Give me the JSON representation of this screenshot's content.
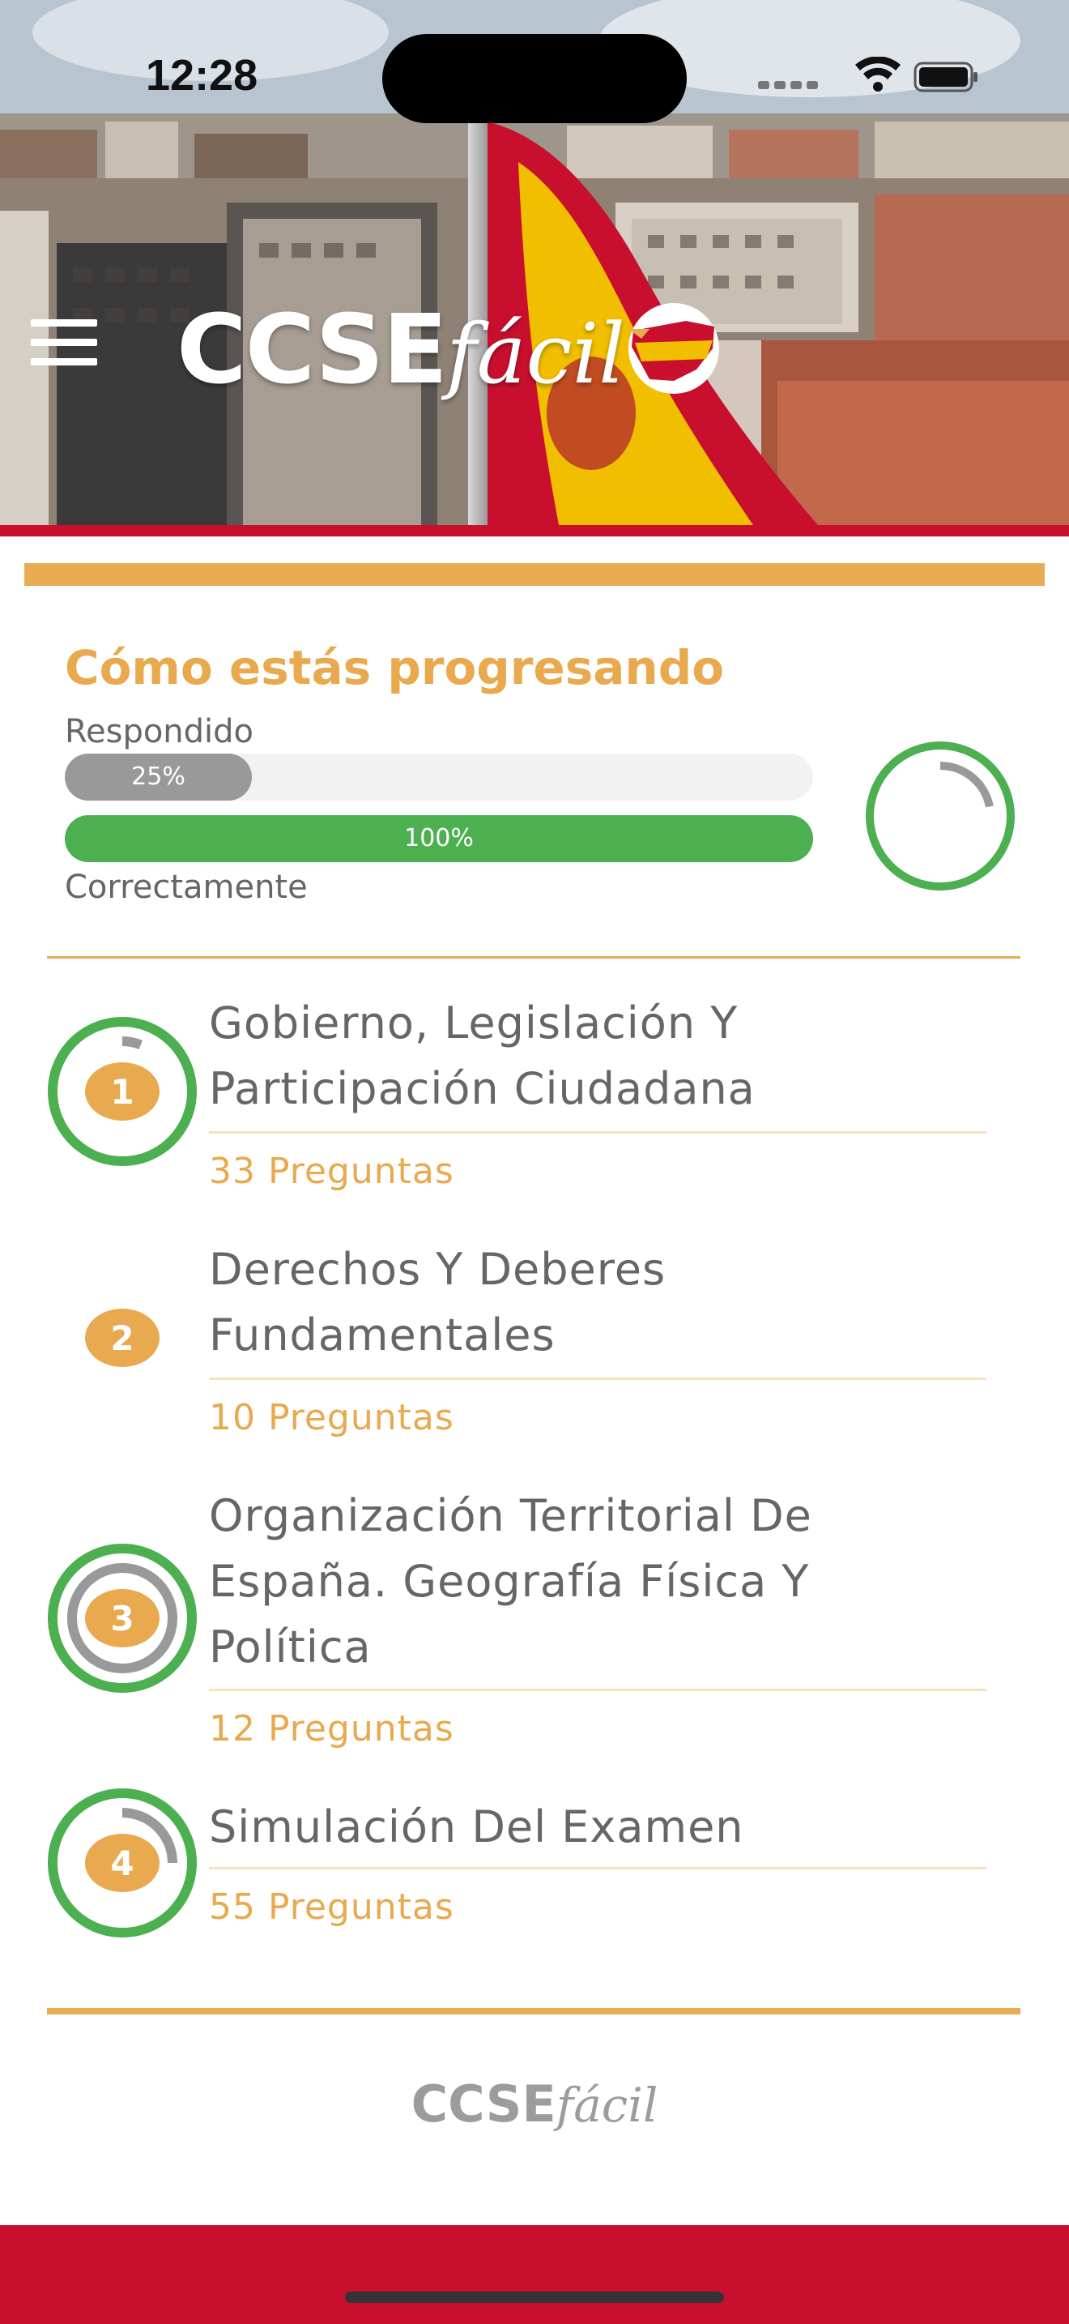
{
  "status_bar": {
    "time": "12:28"
  },
  "header": {
    "logo_primary": "CCSE",
    "logo_secondary": "fácil"
  },
  "progress": {
    "title": "Cómo estás progresando",
    "answered_label": "Respondido",
    "answered_percent": 25,
    "answered_text": "25%",
    "correct_label": "Correctamente",
    "correct_percent": 100,
    "correct_text": "100%",
    "overall_ring_gray_fraction": 0.22
  },
  "sections": [
    {
      "number": "1",
      "title": "Gobierno, Legislación Y Participación Ciudadana",
      "count": "33 Preguntas",
      "green_fraction": 1.0,
      "gray_fraction": 0.06
    },
    {
      "number": "2",
      "title": "Derechos Y Deberes Fundamentales",
      "count": "10 Preguntas",
      "green_fraction": 0,
      "gray_fraction": 0
    },
    {
      "number": "3",
      "title": "Organización Territorial De España. Geografía Física Y Política",
      "count": "12 Preguntas",
      "green_fraction": 1.0,
      "gray_fraction": 1.0
    },
    {
      "number": "4",
      "title": "Simulación Del Examen",
      "count": "55 Preguntas",
      "green_fraction": 1.0,
      "gray_fraction": 0.25
    }
  ],
  "footer": {
    "logo_primary": "CCSE",
    "logo_secondary": "fácil"
  },
  "colors": {
    "accent": "#e8a94f",
    "green": "#4caf50",
    "gray": "#999999",
    "red": "#c8102e",
    "text": "#666666"
  }
}
